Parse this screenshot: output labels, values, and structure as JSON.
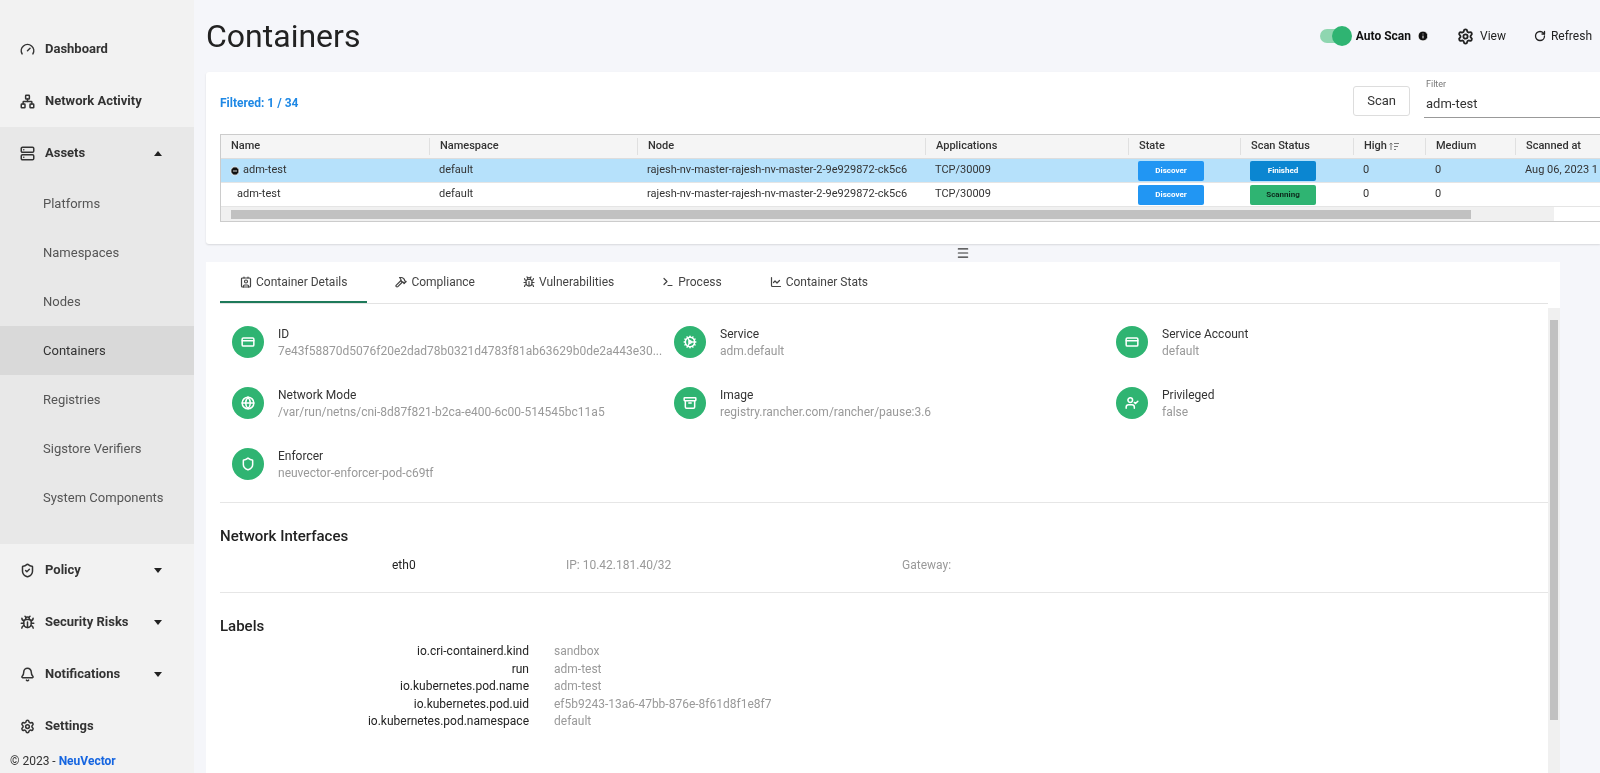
{
  "sidebar": {
    "items": [
      {
        "label": "Dashboard"
      },
      {
        "label": "Network Activity"
      },
      {
        "label": "Assets",
        "expanded": true,
        "children": [
          {
            "label": "Platforms",
            "selected": false
          },
          {
            "label": "Namespaces",
            "selected": false
          },
          {
            "label": "Nodes",
            "selected": false
          },
          {
            "label": "Containers",
            "selected": true
          },
          {
            "label": "Registries",
            "selected": false
          },
          {
            "label": "Sigstore Verifiers",
            "selected": false
          },
          {
            "label": "System Components",
            "selected": false
          }
        ]
      },
      {
        "label": "Policy",
        "expanded": false
      },
      {
        "label": "Security Risks",
        "expanded": false
      },
      {
        "label": "Notifications",
        "expanded": false
      },
      {
        "label": "Settings"
      }
    ],
    "footer": {
      "text": "© 2023 - ",
      "link": "NeuVector"
    }
  },
  "page_title": "Containers",
  "header_actions": {
    "auto_scan": {
      "label": "Auto Scan",
      "on": true
    },
    "view": "View",
    "refresh": "Refresh"
  },
  "filter_summary": "Filtered: 1 / 34",
  "scan_button": "Scan",
  "filter": {
    "label": "Filter",
    "value": "adm-test"
  },
  "table": {
    "columns": [
      "Name",
      "Namespace",
      "Node",
      "Applications",
      "State",
      "Scan Status",
      "High",
      "Medium",
      "Scanned at"
    ],
    "rows": [
      {
        "kind": "parent",
        "selected": true,
        "name": "adm-test",
        "namespace": "default",
        "node": "rajesh-nv-master-rajesh-nv-master-2-9e929872-ck5c6",
        "applications": "TCP/30009",
        "state": "Discover",
        "scan_status": {
          "text": "Finished",
          "color": "#0b86d1"
        },
        "high": "0",
        "medium": "0",
        "scanned_at": "Aug 06, 2023 1"
      },
      {
        "kind": "child",
        "selected": false,
        "name": "adm-test",
        "namespace": "default",
        "node": "rajesh-nv-master-rajesh-nv-master-2-9e929872-ck5c6",
        "applications": "TCP/30009",
        "state": "Discover",
        "scan_status": {
          "text": "Scanning",
          "color": "#2fb472"
        },
        "high": "0",
        "medium": "0",
        "scanned_at": ""
      }
    ]
  },
  "tabs": [
    {
      "label": "Container Details",
      "selected": true
    },
    {
      "label": "Compliance",
      "selected": false
    },
    {
      "label": "Vulnerabilities",
      "selected": false
    },
    {
      "label": "Process",
      "selected": false
    },
    {
      "label": "Container Stats",
      "selected": false
    }
  ],
  "details": [
    {
      "label": "ID",
      "value": "7e43f58870d5076f20e2dad78b0321d4783f81ab63629b0de2a443e30..."
    },
    {
      "label": "Service",
      "value": "adm.default"
    },
    {
      "label": "Service Account",
      "value": "default"
    },
    {
      "label": "Network Mode",
      "value": "/var/run/netns/cni-8d87f821-b2ca-e400-6c00-514545bc11a5"
    },
    {
      "label": "Image",
      "value": "registry.rancher.com/rancher/pause:3.6"
    },
    {
      "label": "Privileged",
      "value": "false"
    },
    {
      "label": "Enforcer",
      "value": "neuvector-enforcer-pod-c69tf"
    }
  ],
  "network_interfaces": {
    "title": "Network Interfaces",
    "rows": [
      {
        "name": "eth0",
        "ip": "IP: 10.42.181.40/32",
        "gateway": "Gateway:"
      }
    ]
  },
  "labels": {
    "title": "Labels",
    "rows": [
      {
        "key": "io.cri-containerd.kind",
        "value": "sandbox"
      },
      {
        "key": "run",
        "value": "adm-test"
      },
      {
        "key": "io.kubernetes.pod.name",
        "value": "adm-test"
      },
      {
        "key": "io.kubernetes.pod.uid",
        "value": "ef5b9243-13a6-47bb-876e-8f61d8f1e8f7"
      },
      {
        "key": "io.kubernetes.pod.namespace",
        "value": "default"
      }
    ]
  }
}
